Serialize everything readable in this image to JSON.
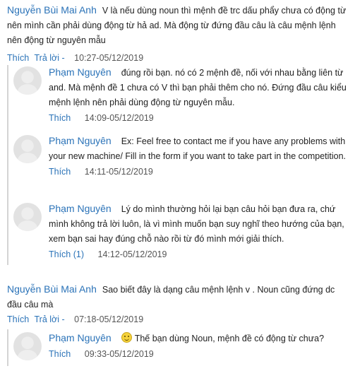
{
  "threads": [
    {
      "author": "Nguyễn Bùi Mai Anh",
      "text": "V là nếu dùng noun thì mệnh đề trc dấu phẩy chưa có động từ nên mình cần phải dùng động từ hả ad. Mà động từ đứng đầu câu là câu mệnh lệnh nên động từ nguyên mẫu",
      "like_label": "Thích",
      "reply_label": "Trả lời -",
      "time": "10:27-05/12/2019",
      "replies": [
        {
          "author": "Phạm Nguyên",
          "text": "đúng rồi bạn. nó có 2 mệnh đề, nối với nhau bằng liên từ and. Mà mệnh đề 1 chưa có V thì bạn phải thêm cho nó. Đứng đầu câu kiểu mệnh lệnh nên phải dùng động từ nguyên mẫu.",
          "like_label": "Thích",
          "time": "14:09-05/12/2019"
        },
        {
          "author": "Phạm Nguyên",
          "text": "Ex: Feel free to contact me if you have any problems with your new machine/ Fill in the form if you want to take part in the competition.",
          "like_label": "Thích",
          "time": "14:11-05/12/2019"
        },
        {
          "author": "Phạm Nguyên",
          "text": "Lý do mình thường hỏi lại bạn câu hỏi bạn đưa ra, chứ mình không trả lời luôn, là vì mình muốn bạn suy nghĩ theo hướng của bạn, xem bạn sai hay đúng chỗ nào rồi từ đó mình mới giải thích.",
          "like_label": "Thích (1)",
          "time": "14:12-05/12/2019"
        }
      ]
    },
    {
      "author": "Nguyễn Bùi Mai Anh",
      "text": "Sao biết đây là dạng câu mệnh lệnh v . Noun cũng đứng dc đầu câu mà",
      "like_label": "Thích",
      "reply_label": "Trả lời -",
      "time": "07:18-05/12/2019",
      "replies": [
        {
          "author": "Phạm Nguyên",
          "icon": "smile-emoji-icon",
          "text": "Thế bạn dùng Noun, mệnh đề có động từ chưa?",
          "like_label": "Thích",
          "time": "09:33-05/12/2019"
        }
      ]
    }
  ]
}
